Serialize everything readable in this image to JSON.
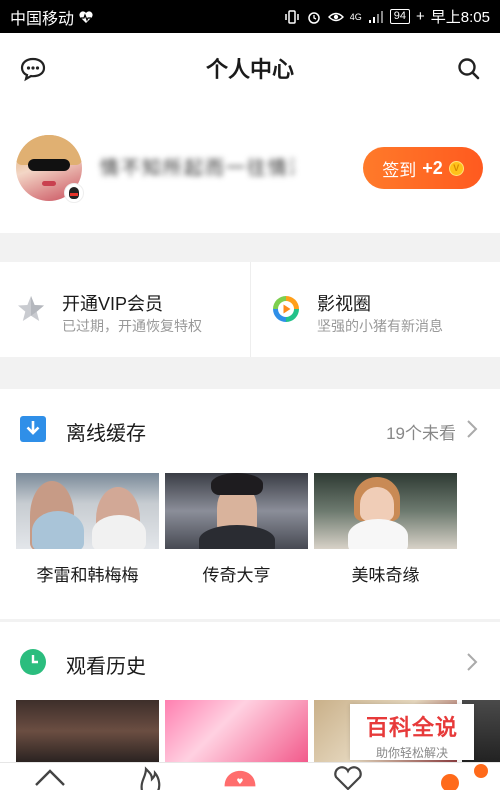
{
  "statusbar": {
    "carrier": "中国移动",
    "signal_type": "4G",
    "battery": "94",
    "time": "早上8:05"
  },
  "header": {
    "title": "个人中心",
    "left_icon": "message-icon",
    "right_icon": "search-icon"
  },
  "profile": {
    "username_blurred": "情不知所起而一往情深",
    "signin_label": "签到",
    "signin_reward": "+2",
    "coin_symbol": "V"
  },
  "features": {
    "vip": {
      "title": "开通VIP会员",
      "subtitle": "已过期，开通恢复特权",
      "icon": "star-icon"
    },
    "circle": {
      "title": "影视圈",
      "subtitle": "坚强的小猪有新消息",
      "icon": "play-circle-icon"
    }
  },
  "offline": {
    "title": "离线缓存",
    "meta": "19个未看",
    "items": [
      {
        "caption": "李雷和韩梅梅"
      },
      {
        "caption": "传奇大亨"
      },
      {
        "caption": "美味奇缘"
      }
    ]
  },
  "history": {
    "title": "观看历史"
  },
  "watermark": {
    "title": "百科全说",
    "subtitle": "助你轻松解决"
  },
  "tabs": [
    "home-icon",
    "hot-icon",
    "center-icon",
    "heart-icon",
    "profile-icon"
  ],
  "colors": {
    "accent": "#ff6a1a",
    "section_blue": "#2f8fe8",
    "history_green": "#2bbd7e"
  }
}
